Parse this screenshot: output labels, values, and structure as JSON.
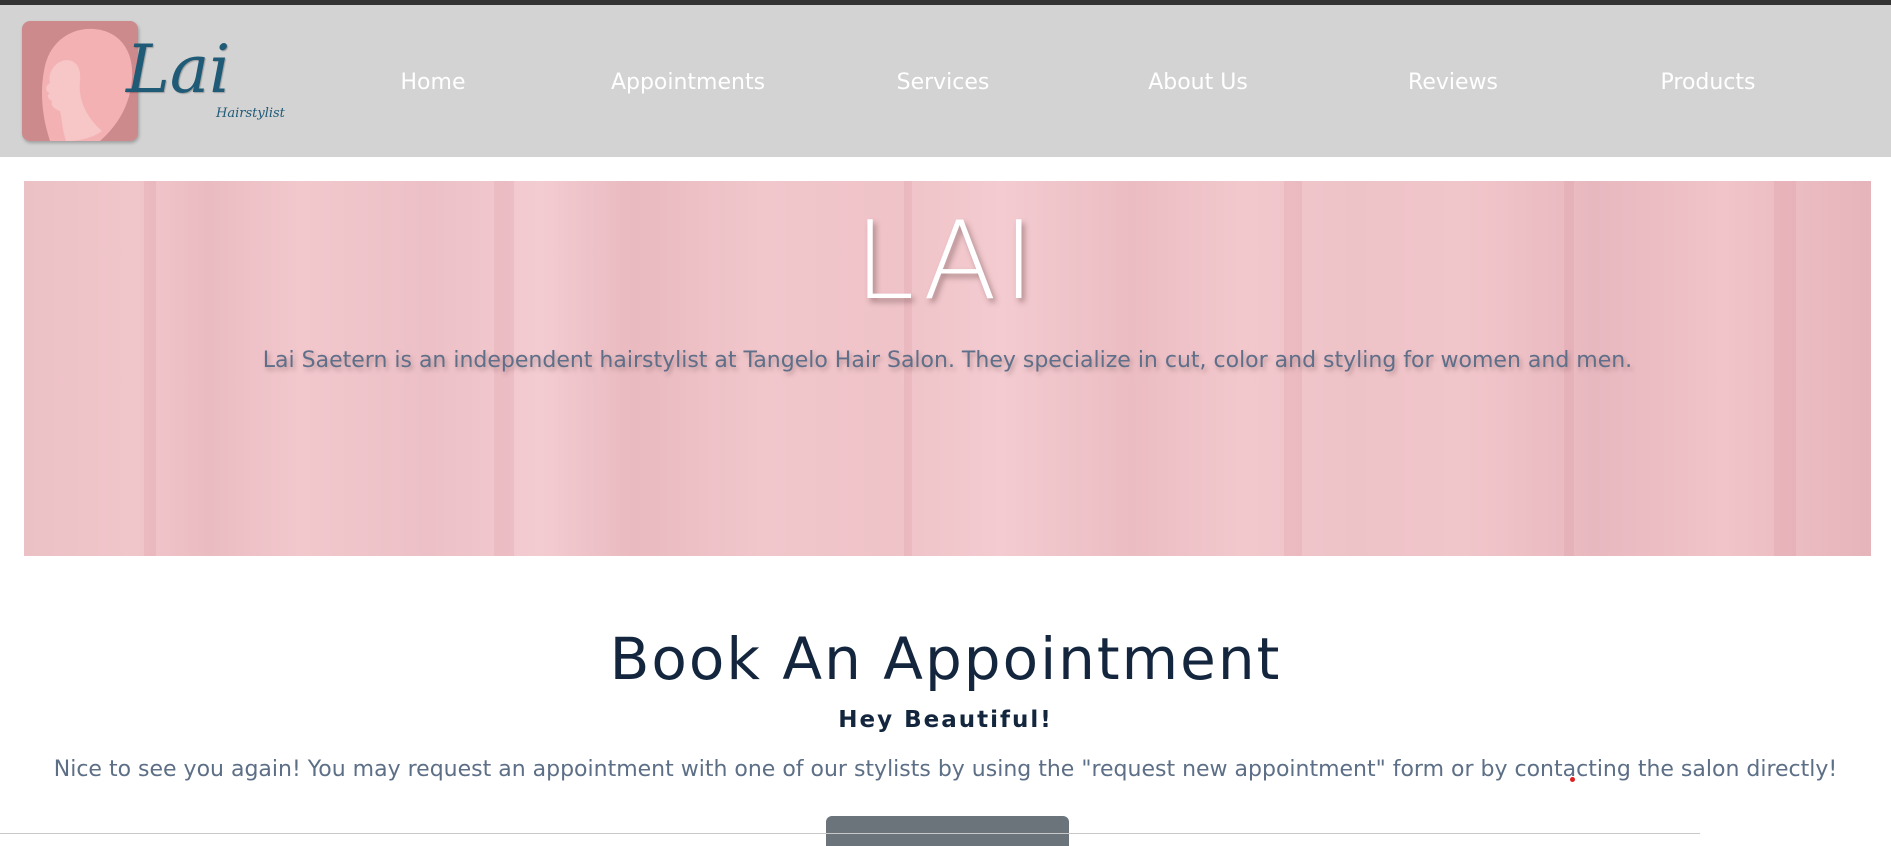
{
  "logo": {
    "word": "Lai",
    "subtitle": "Hairstylist"
  },
  "nav": {
    "items": [
      {
        "label": "Home"
      },
      {
        "label": "Appointments"
      },
      {
        "label": "Services"
      },
      {
        "label": "About Us"
      },
      {
        "label": "Reviews"
      },
      {
        "label": "Products"
      }
    ]
  },
  "hero": {
    "title": "LAI",
    "description": "Lai Saetern is an independent hairstylist at Tangelo Hair Salon. They specialize in cut, color and styling for women and men."
  },
  "booking": {
    "title": "Book An Appointment",
    "subtitle": "Hey Beautiful!",
    "text": "Nice to see you again! You may request an appointment with one of our stylists by using the \"request new appointment\" form or by contacting the salon directly!"
  },
  "colors": {
    "navbar_bg": "#d3d3d3",
    "logo_bg": "#cd8a8d",
    "logo_text": "#1f5a77",
    "hero_bg": "#efc3c8",
    "heading": "#13263d",
    "body_text": "#5d6f86",
    "button": "#6b737b"
  }
}
